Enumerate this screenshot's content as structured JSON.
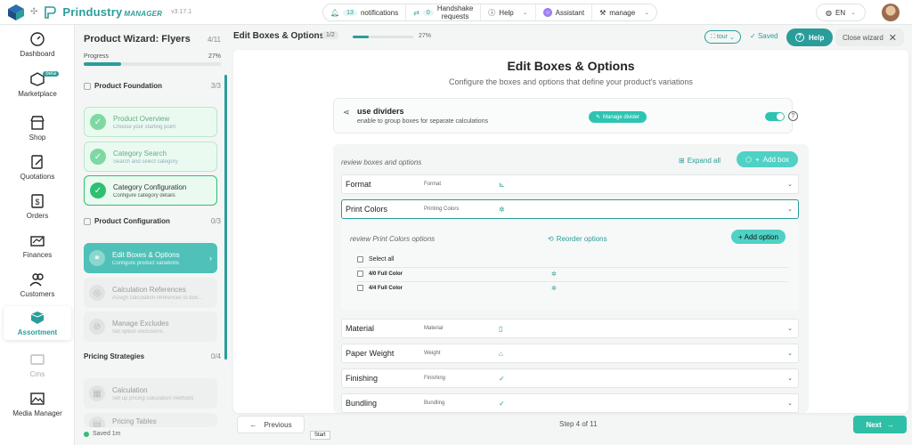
{
  "app": {
    "brand": "Prindustry",
    "brand_suffix": "MANAGER",
    "version": "v3.17.1"
  },
  "topbar": {
    "notifications_count": "13",
    "notifications_label": "notifications",
    "handshake_count": "0",
    "handshake_label_1": "Handshake",
    "handshake_label_2": "requests",
    "help_label": "Help",
    "assistant_label": "Assistant",
    "manage_label": "manage",
    "language": "EN"
  },
  "nav": {
    "dashboard": "Dashboard",
    "marketplace": "Marketplace",
    "marketplace_badge": "beta",
    "shop": "Shop",
    "quotations": "Quotations",
    "orders": "Orders",
    "finances": "Finances",
    "customers": "Customers",
    "assortment": "Assortment",
    "cms": "Cms",
    "media_manager": "Media Manager"
  },
  "wizard": {
    "title": "Product Wizard: Flyers",
    "count": "4/11",
    "progress_label": "Progress",
    "progress_pct": "27%",
    "progress_value": 27,
    "sections": [
      {
        "title": "Product Foundation",
        "count": "3/3"
      },
      {
        "title": "Product Configuration",
        "count": "0/3"
      },
      {
        "title": "Pricing Strategies",
        "count": "0/4"
      }
    ],
    "steps": [
      {
        "title": "Product Overview",
        "desc": "Choose your starting point"
      },
      {
        "title": "Category Search",
        "desc": "Search and select category"
      },
      {
        "title": "Category Configuration",
        "desc": "Configure category details"
      },
      {
        "title": "Edit Boxes & Options",
        "desc": "Configure product variations"
      },
      {
        "title": "Calculation References",
        "desc": "Assign calculation references to box..."
      },
      {
        "title": "Manage Excludes",
        "desc": "Set option exclusions"
      },
      {
        "title": "Calculation",
        "desc": "Set up pricing calculation methods"
      },
      {
        "title": "Pricing Tables",
        "desc": ""
      }
    ],
    "saved": "Saved 1m"
  },
  "header": {
    "title": "Edit Boxes & Options",
    "step_badge": "1/2",
    "progress_pct": "27%",
    "progress_value": 27,
    "tour": "tour",
    "saved": "Saved",
    "help": "Help",
    "close": "Close wizard"
  },
  "main": {
    "title": "Edit Boxes & Options",
    "subtitle": "Configure the boxes and options that define your product's variations",
    "dividers_title": "use dividers",
    "dividers_sub": "enable to group boxes for separate calculations",
    "manage_divider": "Manage divider",
    "review_label": "review boxes and options",
    "expand_all": "Expand all",
    "add_box": "Add box",
    "boxes": [
      {
        "name": "Format",
        "sub": "Format"
      },
      {
        "name": "Print Colors",
        "sub": "Printing Colors"
      },
      {
        "name": "Material",
        "sub": "Material"
      },
      {
        "name": "Paper Weight",
        "sub": "Weight"
      },
      {
        "name": "Finishing",
        "sub": "Finishing"
      },
      {
        "name": "Bundling",
        "sub": "Bundling"
      }
    ],
    "options_label": "review Print Colors options",
    "reorder": "Reorder options",
    "add_option": "Add option",
    "select_all": "Select all",
    "options": [
      "4/0 Full Color",
      "4/4 Full Color"
    ]
  },
  "footer": {
    "previous": "Previous",
    "step": "Step 4 of 11",
    "next": "Next",
    "tooltip": "Start"
  },
  "colors": {
    "accent": "#2a9d9a",
    "accent_light": "#4fd1c5",
    "success": "#2fbf71"
  }
}
